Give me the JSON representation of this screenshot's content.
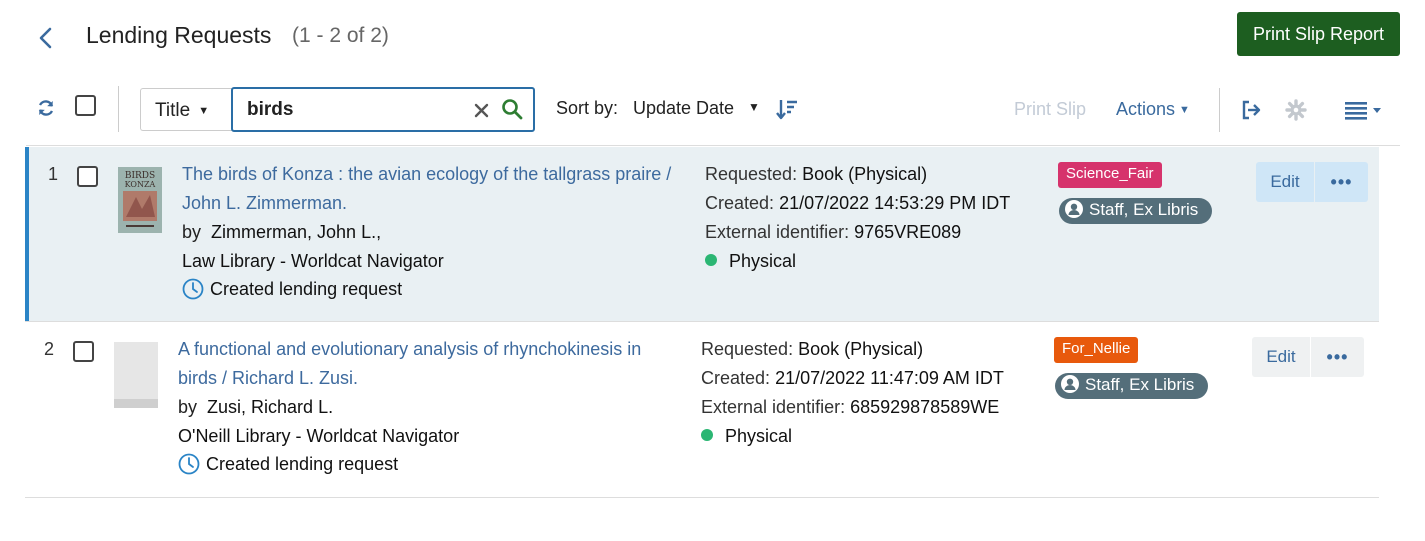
{
  "header": {
    "title": "Lending Requests",
    "count": "(1 - 2 of 2)",
    "print_report_label": "Print Slip Report"
  },
  "toolbar": {
    "field_select": "Title",
    "search_value": "birds",
    "sort_label": "Sort by:",
    "sort_value": "Update Date",
    "print_slip_label": "Print Slip",
    "actions_label": "Actions"
  },
  "rows": [
    {
      "index": "1",
      "title": "The birds of Konza : the avian ecology of the tallgrass praire / John L. Zimmerman.",
      "by_prefix": "by",
      "author": "Zimmerman, John L.,",
      "library": "Law Library - Worldcat Navigator",
      "status": "Created lending request",
      "requested_label": "Requested:",
      "requested_value": "Book (Physical)",
      "created_label": "Created:",
      "created_value": "21/07/2022 14:53:29 PM IDT",
      "external_label": "External identifier:",
      "external_value": "9765VRE089",
      "format": "Physical",
      "tag": "Science_Fair",
      "tag_color": "#d6336c",
      "assignee": "Staff, Ex Libris",
      "edit_label": "Edit",
      "more_label": "•••",
      "cover_text": "BIRDS KONZA"
    },
    {
      "index": "2",
      "title": "A functional and evolutionary analysis of rhynchokinesis in birds / Richard L. Zusi.",
      "by_prefix": "by",
      "author": "Zusi, Richard L.",
      "library": "O'Neill Library - Worldcat Navigator",
      "status": "Created lending request",
      "requested_label": "Requested:",
      "requested_value": "Book (Physical)",
      "created_label": "Created:",
      "created_value": "21/07/2022 11:47:09 AM IDT",
      "external_label": "External identifier:",
      "external_value": "685929878589WE",
      "format": "Physical",
      "tag": "For_Nellie",
      "tag_color": "#e8590c",
      "assignee": "Staff, Ex Libris",
      "edit_label": "Edit",
      "more_label": "•••"
    }
  ],
  "colors": {
    "primary_button": "#1d5e20",
    "link": "#3d6a9e",
    "selected_row": "#e9f0f3",
    "selected_bar": "#2a84c6",
    "physical_dot": "#2bb673",
    "assignee_chip": "#546e7a"
  }
}
